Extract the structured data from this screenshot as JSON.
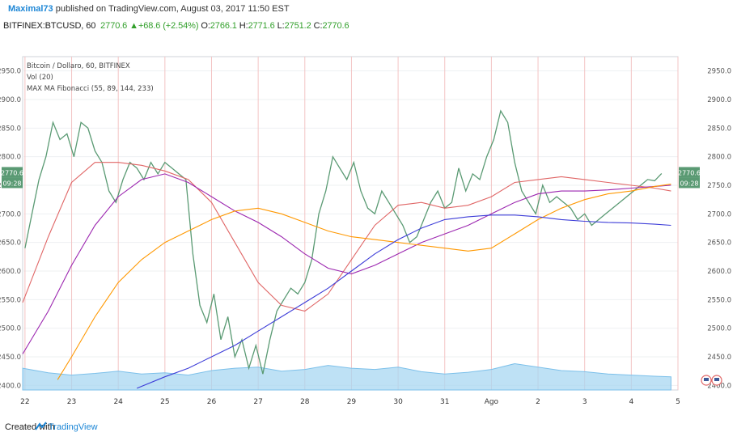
{
  "header": {
    "author": "Maximal73",
    "published_text": "published on TradingView.com, August 03, 2017 11:50 EST",
    "symbol": "BITFINEX:BTCUSD, 60",
    "last": "2770.6",
    "change": "▲+68.6 (+2.54%)",
    "open_label": "O:",
    "open": "2766.1",
    "high_label": "H:",
    "high": "2771.6",
    "low_label": "L:",
    "low": "2751.2",
    "close_label": "C:",
    "close": "2770.6"
  },
  "chart_data": {
    "type": "line",
    "legend": [
      "Bitcoin / Dollaro, 60, BITFINEX",
      "Vol (20)",
      "MAX MA Fibonacci (55, 89, 144, 233)"
    ],
    "x_tick_labels": [
      "22",
      "23",
      "24",
      "25",
      "26",
      "27",
      "28",
      "29",
      "30",
      "31",
      "Ago",
      "2",
      "3",
      "4",
      "5"
    ],
    "y_tick_labels": [
      "2950.0",
      "2900.0",
      "2850.0",
      "2800.0",
      "2750.0",
      "2700.0",
      "2650.0",
      "2600.0",
      "2550.0",
      "2500.0",
      "2450.0",
      "2400.0"
    ],
    "ylim": [
      2392,
      2975
    ],
    "xlim": [
      -0.05,
      14.0
    ],
    "grid": true,
    "last_price_label": "2770.6",
    "countdown_label": "09:28",
    "series": [
      {
        "name": "price",
        "color": "#5a9a73",
        "x": [
          0.0,
          0.15,
          0.3,
          0.45,
          0.6,
          0.75,
          0.9,
          1.05,
          1.2,
          1.35,
          1.5,
          1.65,
          1.8,
          1.95,
          2.1,
          2.25,
          2.4,
          2.55,
          2.7,
          2.85,
          3.0,
          3.15,
          3.3,
          3.45,
          3.6,
          3.75,
          3.9,
          4.05,
          4.2,
          4.35,
          4.5,
          4.65,
          4.8,
          4.95,
          5.1,
          5.25,
          5.4,
          5.55,
          5.7,
          5.85,
          6.0,
          6.15,
          6.3,
          6.45,
          6.6,
          6.75,
          6.9,
          7.05,
          7.2,
          7.35,
          7.5,
          7.65,
          7.8,
          7.95,
          8.1,
          8.25,
          8.4,
          8.55,
          8.7,
          8.85,
          9.0,
          9.15,
          9.3,
          9.45,
          9.6,
          9.75,
          9.9,
          10.05,
          10.2,
          10.35,
          10.5,
          10.65,
          10.8,
          10.95,
          11.1,
          11.25,
          11.4,
          11.55,
          11.7,
          11.85,
          12.0,
          12.15,
          12.3,
          12.45,
          12.6,
          12.75,
          12.9,
          13.05,
          13.2,
          13.35,
          13.5,
          13.65
        ],
        "values": [
          2640,
          2700,
          2760,
          2800,
          2860,
          2830,
          2840,
          2800,
          2860,
          2850,
          2810,
          2790,
          2740,
          2720,
          2760,
          2790,
          2780,
          2760,
          2790,
          2770,
          2790,
          2780,
          2770,
          2760,
          2630,
          2540,
          2510,
          2560,
          2480,
          2520,
          2450,
          2480,
          2430,
          2470,
          2420,
          2480,
          2530,
          2550,
          2570,
          2560,
          2580,
          2620,
          2700,
          2740,
          2800,
          2780,
          2760,
          2790,
          2740,
          2710,
          2700,
          2740,
          2720,
          2700,
          2680,
          2650,
          2660,
          2690,
          2720,
          2740,
          2710,
          2720,
          2780,
          2740,
          2770,
          2760,
          2800,
          2830,
          2880,
          2860,
          2790,
          2740,
          2720,
          2700,
          2750,
          2720,
          2730,
          2720,
          2710,
          2690,
          2700,
          2680,
          2690,
          2700,
          2710,
          2720,
          2730,
          2740,
          2750,
          2760,
          2758,
          2770.6
        ]
      },
      {
        "name": "MA 55",
        "color": "#e06666",
        "x": [
          -0.05,
          0.5,
          1.0,
          1.5,
          2.0,
          2.5,
          3.0,
          3.5,
          4.0,
          4.5,
          5.0,
          5.5,
          6.0,
          6.5,
          7.0,
          7.5,
          8.0,
          8.5,
          9.0,
          9.5,
          10.0,
          10.5,
          11.0,
          11.5,
          12.0,
          12.5,
          13.0,
          13.5,
          13.85
        ],
        "values": [
          2545,
          2660,
          2755,
          2790,
          2790,
          2785,
          2775,
          2760,
          2720,
          2650,
          2580,
          2540,
          2530,
          2560,
          2620,
          2680,
          2715,
          2720,
          2710,
          2715,
          2730,
          2755,
          2760,
          2765,
          2760,
          2755,
          2750,
          2745,
          2740
        ]
      },
      {
        "name": "MA 89",
        "color": "#9c27b0",
        "x": [
          -0.05,
          0.5,
          1.0,
          1.5,
          2.0,
          2.5,
          3.0,
          3.5,
          4.0,
          4.5,
          5.0,
          5.5,
          6.0,
          6.5,
          7.0,
          7.5,
          8.0,
          8.5,
          9.0,
          9.5,
          10.0,
          10.5,
          11.0,
          11.5,
          12.0,
          12.5,
          13.0,
          13.5,
          13.85
        ],
        "values": [
          2455,
          2530,
          2610,
          2680,
          2730,
          2760,
          2770,
          2755,
          2730,
          2705,
          2685,
          2660,
          2630,
          2605,
          2595,
          2610,
          2630,
          2650,
          2665,
          2680,
          2700,
          2720,
          2735,
          2740,
          2740,
          2742,
          2745,
          2748,
          2750
        ]
      },
      {
        "name": "MA 144",
        "color": "#ff9800",
        "x": [
          0.7,
          1.0,
          1.5,
          2.0,
          2.5,
          3.0,
          3.5,
          4.0,
          4.5,
          5.0,
          5.5,
          6.0,
          6.5,
          7.0,
          7.5,
          8.0,
          8.5,
          9.0,
          9.5,
          10.0,
          10.5,
          11.0,
          11.5,
          12.0,
          12.5,
          13.0,
          13.5,
          13.85
        ],
        "values": [
          2410,
          2450,
          2520,
          2580,
          2620,
          2650,
          2670,
          2690,
          2705,
          2710,
          2700,
          2685,
          2670,
          2660,
          2655,
          2650,
          2645,
          2640,
          2635,
          2640,
          2665,
          2690,
          2710,
          2725,
          2735,
          2740,
          2748,
          2752
        ]
      },
      {
        "name": "MA 233",
        "color": "#3d3dd8",
        "x": [
          2.4,
          3.0,
          3.5,
          4.0,
          4.5,
          5.0,
          5.5,
          6.0,
          6.5,
          7.0,
          7.5,
          8.0,
          8.5,
          9.0,
          9.5,
          10.0,
          10.5,
          11.0,
          11.5,
          12.0,
          12.5,
          13.0,
          13.5,
          13.85
        ],
        "values": [
          2395,
          2415,
          2430,
          2450,
          2470,
          2495,
          2520,
          2545,
          2570,
          2600,
          2630,
          2655,
          2675,
          2690,
          2695,
          2698,
          2698,
          2695,
          2690,
          2687,
          2685,
          2684,
          2682,
          2680
        ]
      }
    ],
    "volume_area": {
      "name": "Vol (20)",
      "x": [
        -0.05,
        0.5,
        1.0,
        1.5,
        2.0,
        2.5,
        3.0,
        3.5,
        4.0,
        4.5,
        5.0,
        5.5,
        6.0,
        6.5,
        7.0,
        7.5,
        8.0,
        8.5,
        9.0,
        9.5,
        10.0,
        10.5,
        11.0,
        11.5,
        12.0,
        12.5,
        13.0,
        13.5,
        13.85
      ],
      "values": [
        2430,
        2422,
        2418,
        2421,
        2425,
        2420,
        2422,
        2418,
        2426,
        2430,
        2432,
        2425,
        2428,
        2435,
        2430,
        2428,
        2432,
        2424,
        2420,
        2423,
        2428,
        2438,
        2432,
        2426,
        2424,
        2420,
        2418,
        2416,
        2415
      ]
    }
  },
  "footer": {
    "created_with": "Created with",
    "brand": "TradingView"
  }
}
